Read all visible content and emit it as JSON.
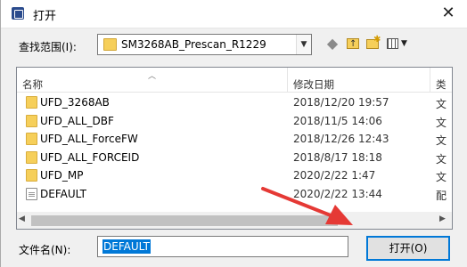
{
  "window": {
    "title": "打开",
    "close_glyph": "✕"
  },
  "lookin": {
    "label": "查找范围(I):",
    "value": "SM3268AB_Prescan_R1229",
    "arrow_glyph": "▼"
  },
  "toolbar": {
    "back_glyph": "◆",
    "view_dropdown_glyph": "▼"
  },
  "list": {
    "headers": {
      "name": "名称",
      "date": "修改日期",
      "type": "类"
    },
    "rows": [
      {
        "name": "UFD_3268AB",
        "date": "2018/12/20 19:57",
        "type": "文",
        "icon": "folder-icon"
      },
      {
        "name": "UFD_ALL_DBF",
        "date": "2018/11/5 14:06",
        "type": "文",
        "icon": "folder-icon"
      },
      {
        "name": "UFD_ALL_ForceFW",
        "date": "2018/12/26 12:43",
        "type": "文",
        "icon": "folder-icon"
      },
      {
        "name": "UFD_ALL_FORCEID",
        "date": "2018/8/17 18:18",
        "type": "文",
        "icon": "folder-icon"
      },
      {
        "name": "UFD_MP",
        "date": "2020/2/22 1:47",
        "type": "文",
        "icon": "folder-icon"
      },
      {
        "name": "DEFAULT",
        "date": "2020/2/22 13:44",
        "type": "配",
        "icon": "document-icon"
      }
    ],
    "scroll_left_glyph": "◀",
    "scroll_right_glyph": "▶"
  },
  "filename": {
    "label": "文件名(N):",
    "value": "DEFAULT"
  },
  "buttons": {
    "open_label": "打开(O)"
  },
  "colors": {
    "selection": "#0078d7",
    "annotation_arrow": "#e53935",
    "folder": "#f6cf5a"
  }
}
